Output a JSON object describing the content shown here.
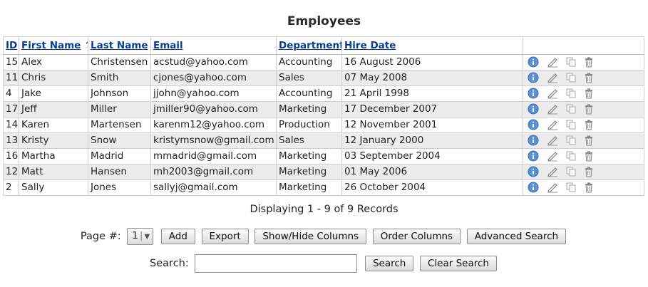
{
  "page_title": "Employees",
  "columns": {
    "id": "ID",
    "first_name": "First Name",
    "sort_indicator": "↑",
    "last_name": "Last Name",
    "email": "Email",
    "department": "Department",
    "hire_date": "Hire Date"
  },
  "rows": [
    {
      "id": "15",
      "first": "Alex",
      "last": "Christensen",
      "email": "acstud@yahoo.com",
      "dept": "Accounting",
      "hire": "16 August 2006"
    },
    {
      "id": "11",
      "first": "Chris",
      "last": "Smith",
      "email": "cjones@yahoo.com",
      "dept": "Sales",
      "hire": "07 May 2008"
    },
    {
      "id": "4",
      "first": "Jake",
      "last": "Johnson",
      "email": "jjohn@yahoo.com",
      "dept": "Accounting",
      "hire": "21 April 1998"
    },
    {
      "id": "17",
      "first": "Jeff",
      "last": "Miller",
      "email": "jmiller90@yahoo.com",
      "dept": "Marketing",
      "hire": "17 December 2007"
    },
    {
      "id": "14",
      "first": "Karen",
      "last": "Martensen",
      "email": "karenm12@yahoo.com",
      "dept": "Production",
      "hire": "12 November 2001"
    },
    {
      "id": "13",
      "first": "Kristy",
      "last": "Snow",
      "email": "kristymsnow@gmail.com",
      "dept": "Sales",
      "hire": "12 January 2000"
    },
    {
      "id": "16",
      "first": "Martha",
      "last": "Madrid",
      "email": "mmadrid@gmail.com",
      "dept": "Marketing",
      "hire": "03 September 2004"
    },
    {
      "id": "12",
      "first": "Matt",
      "last": "Hansen",
      "email": "mh2003@gmail.com",
      "dept": "Marketing",
      "hire": "01 May 2006"
    },
    {
      "id": "2",
      "first": "Sally",
      "last": "Jones",
      "email": "sallyj@gmail.com",
      "dept": "Marketing",
      "hire": "26 October 2004"
    }
  ],
  "row_action_icons": [
    "info-icon",
    "edit-icon",
    "copy-icon",
    "delete-icon"
  ],
  "footer": {
    "display_text": "Displaying 1 - 9 of 9 Records",
    "page_label": "Page #:",
    "page_selected": "1",
    "add_label": "Add",
    "export_label": "Export",
    "show_hide_label": "Show/Hide Columns",
    "order_label": "Order Columns",
    "advanced_label": "Advanced Search",
    "search_label": "Search:",
    "search_value": "",
    "search_button_label": "Search",
    "clear_label": "Clear Search"
  },
  "colors": {
    "header_link": "#0a3d91",
    "row_alt": "#ececec",
    "info_icon": "#5b8fd6"
  }
}
